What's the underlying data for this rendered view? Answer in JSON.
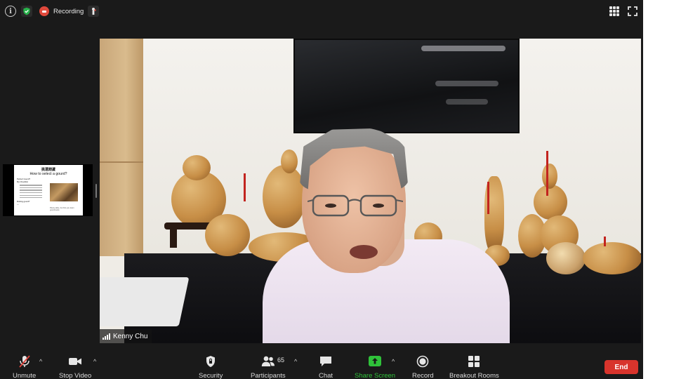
{
  "window": {
    "recording_label": "Recording"
  },
  "shared_screen": {
    "title_line1": "挑選葫蘆",
    "title_line2": "How to select a gourd?",
    "bullets": [
      "Perfect Gourd?",
      "My Checklist",
      "Rotting gourd?",
      "—"
    ],
    "note": "Plenty alike, but first you learn gourd-looks"
  },
  "video": {
    "participant_name": "Kenny Chu"
  },
  "toolbar": {
    "unmute_label": "Unmute",
    "stop_video_label": "Stop Video",
    "security_label": "Security",
    "participants_label": "Participants",
    "participants_count": "65",
    "chat_label": "Chat",
    "share_screen_label": "Share Screen",
    "record_label": "Record",
    "breakout_rooms_label": "Breakout Rooms",
    "end_label": "End",
    "caret": "^"
  },
  "colors": {
    "background": "#1a1a1a",
    "share_green": "#2fc23a",
    "end_red": "#d8342c",
    "recording_red": "#e0493c",
    "shield_green": "#27b24a"
  },
  "icons": [
    "info-icon",
    "shield-icon",
    "recording-icon",
    "recorder-icon",
    "gallery-view-icon",
    "fullscreen-icon",
    "mic-muted-icon",
    "video-camera-icon",
    "shield-security-icon",
    "participants-icon",
    "chat-icon",
    "share-screen-icon",
    "record-icon",
    "breakout-rooms-icon",
    "signal-bars-icon"
  ]
}
